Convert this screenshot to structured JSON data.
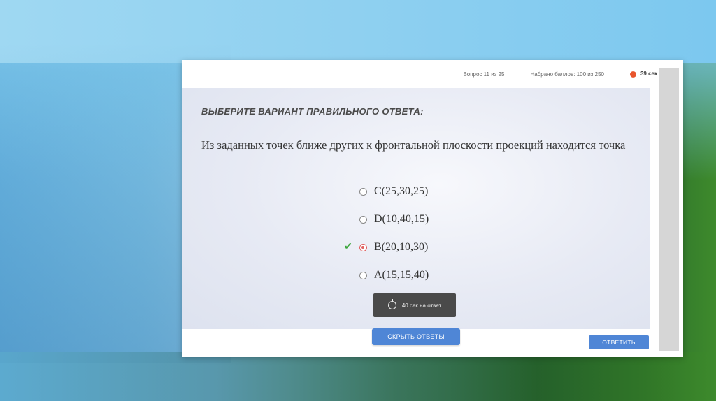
{
  "header": {
    "question_counter": "Вопрос 11 из 25",
    "score": "Набрано баллов: 100 из 250",
    "timer": "39 сек"
  },
  "quiz": {
    "instruction": "ВЫБЕРИТЕ ВАРИАНТ ПРАВИЛЬНОГО ОТВЕТА:",
    "question": "Из заданных точек ближе других к фронтальной плоскости проекций находится точка",
    "options": [
      {
        "label": "C(25,30,25)",
        "selected": false,
        "correct": false
      },
      {
        "label": "D(10,40,15)",
        "selected": false,
        "correct": false
      },
      {
        "label": "B(20,10,30)",
        "selected": true,
        "correct": true
      },
      {
        "label": "A(15,15,40)",
        "selected": false,
        "correct": false
      }
    ],
    "time_per_answer": "40 сек на ответ"
  },
  "buttons": {
    "hide_answers": "СКРЫТЬ ОТВЕТЫ",
    "answer": "ОТВЕТИТЬ"
  },
  "colors": {
    "accent": "#4f86d6",
    "timer_dot": "#e8552d",
    "correct_check": "#3aa53a",
    "selected_radio": "#e06060"
  },
  "icons": {
    "timer": "timer-dot-icon",
    "check": "check-icon",
    "stopwatch": "stopwatch-icon"
  }
}
